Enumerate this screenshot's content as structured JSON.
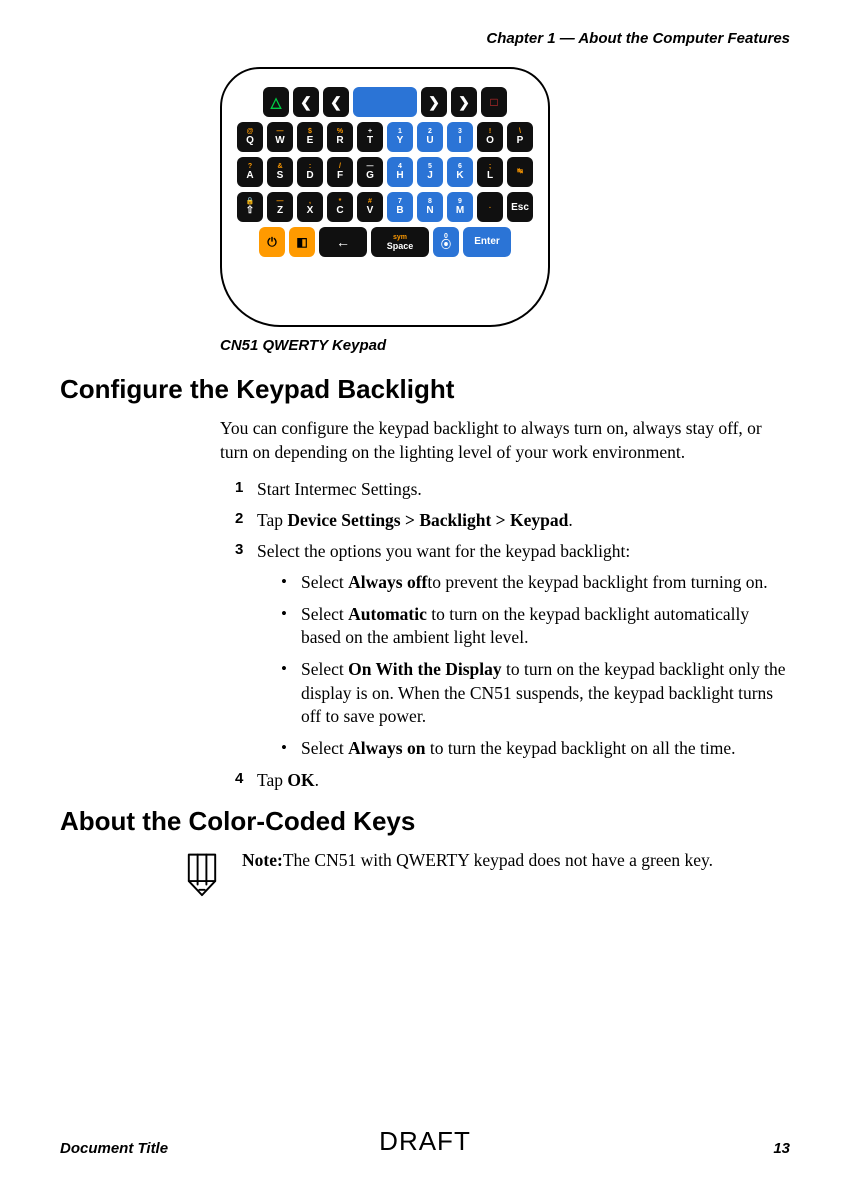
{
  "header": {
    "running": "Chapter 1 — About the Computer Features"
  },
  "figure": {
    "caption": "CN51 QWERTY Keypad"
  },
  "section1": {
    "title": "Configure the Keypad Backlight",
    "intro": "You can configure the keypad backlight to always turn on, always stay off, or turn on depending on the lighting level of your work environment.",
    "step1": "Start Intermec Settings.",
    "step2_a": "Tap ",
    "step2_b": "Device Settings > Backlight > Keypad",
    "step2_c": ".",
    "step3": "Select the options you want for the keypad backlight:",
    "b1_a": "Select ",
    "b1_b": "Always off",
    "b1_c": "to prevent the keypad backlight from turning on.",
    "b2_a": "Select ",
    "b2_b": "Automatic",
    "b2_c": " to turn on the keypad backlight automatically based on the ambient light level.",
    "b3_a": "Select ",
    "b3_b": "On With the Display",
    "b3_c": " to turn on the keypad backlight only the display is on. When the CN51 suspends, the keypad backlight turns off to save power.",
    "b4_a": "Select ",
    "b4_b": "Always on",
    "b4_c": " to turn the keypad backlight on all the time.",
    "step4_a": "Tap ",
    "step4_b": "OK",
    "step4_c": "."
  },
  "section2": {
    "title": "About the Color-Coded Keys",
    "note_label": "Note:",
    "note_text": "The CN51 with QWERTY keypad does not have a green key."
  },
  "footer": {
    "doc": "Document Title",
    "watermark": "DRAFT",
    "page": "13"
  },
  "keypad": {
    "row1": [
      {
        "t": "green",
        "label": "△"
      },
      {
        "t": "black",
        "label": "❮"
      },
      {
        "t": "black",
        "label": "❮"
      },
      {
        "t": "bluewide",
        "label": ""
      },
      {
        "t": "black",
        "label": "❯"
      },
      {
        "t": "black",
        "label": "❯"
      },
      {
        "t": "red",
        "label": "□"
      }
    ],
    "row2": [
      {
        "sup": "@",
        "main": "Q",
        "sc": "orange"
      },
      {
        "sup": "—",
        "main": "W",
        "sc": "orange"
      },
      {
        "sup": "$",
        "main": "E",
        "sc": "orange"
      },
      {
        "sup": "%",
        "main": "R",
        "sc": "orange"
      },
      {
        "sup": "+",
        "main": "T",
        "sc": "blue"
      },
      {
        "sup": "1",
        "main": "Y",
        "sc": "blue",
        "bg": "blue"
      },
      {
        "sup": "2",
        "main": "U",
        "sc": "blue",
        "bg": "blue"
      },
      {
        "sup": "3",
        "main": "I",
        "sc": "blue",
        "bg": "blue"
      },
      {
        "sup": "!",
        "main": "O",
        "sc": "orange"
      },
      {
        "sup": "\\",
        "main": "P",
        "sc": "orange"
      }
    ],
    "row3": [
      {
        "sup": "?",
        "main": "A",
        "sc": "orange"
      },
      {
        "sup": "&",
        "main": "S",
        "sc": "orange"
      },
      {
        "sup": ":",
        "main": "D",
        "sc": "orange"
      },
      {
        "sup": "/",
        "main": "F",
        "sc": "orange"
      },
      {
        "sup": "—",
        "main": "G",
        "sc": "blue"
      },
      {
        "sup": "4",
        "main": "H",
        "sc": "blue",
        "bg": "blue"
      },
      {
        "sup": "5",
        "main": "J",
        "sc": "blue",
        "bg": "blue"
      },
      {
        "sup": "6",
        "main": "K",
        "sc": "blue",
        "bg": "blue"
      },
      {
        "sup": ";",
        "main": "L",
        "sc": "orange"
      },
      {
        "sup": "↹",
        "main": "",
        "sc": "orange"
      }
    ],
    "row4": [
      {
        "sup": "🔒",
        "main": "⇧",
        "sc": "orange"
      },
      {
        "sup": "—",
        "main": "Z",
        "sc": "orange"
      },
      {
        "sup": ",",
        "main": "X",
        "sc": "orange"
      },
      {
        "sup": "*",
        "main": "C",
        "sc": "orange"
      },
      {
        "sup": "#",
        "main": "V",
        "sc": "orange"
      },
      {
        "sup": "7",
        "main": "B",
        "sc": "blue",
        "bg": "blue"
      },
      {
        "sup": "8",
        "main": "N",
        "sc": "blue",
        "bg": "blue"
      },
      {
        "sup": "9",
        "main": "M",
        "sc": "blue",
        "bg": "blue"
      },
      {
        "sup": ".",
        "main": "",
        "sc": "orange"
      },
      {
        "sup": "",
        "main": "Esc",
        "sc": ""
      }
    ],
    "row5": [
      {
        "t": "orange",
        "label": "⏻"
      },
      {
        "t": "orange",
        "label": "◧"
      },
      {
        "t": "blackwide",
        "label": "←"
      },
      {
        "t": "spacewide",
        "sup": "sym",
        "main": "Space"
      },
      {
        "t": "bluekey",
        "sup": "0",
        "main": "⦿"
      },
      {
        "t": "enter",
        "label": "Enter"
      }
    ]
  }
}
